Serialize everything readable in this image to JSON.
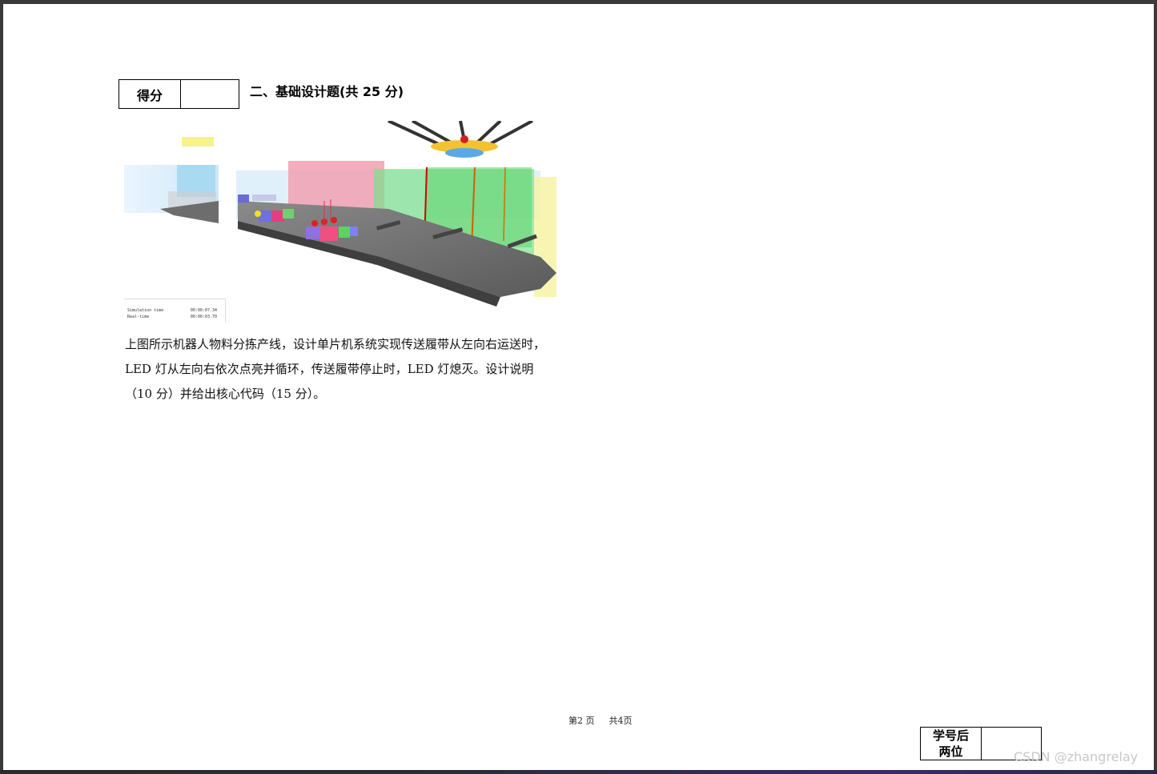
{
  "score_box": {
    "label": "得分",
    "value": ""
  },
  "section": {
    "title": "二、基础设计题(共 25 分)"
  },
  "figure": {
    "sim_time_label": "Simulation time",
    "sim_time_value": "00:00:07.34",
    "real_time_label": "Real-time",
    "real_time_value": "00:00:03.70"
  },
  "question": {
    "lines": [
      "上图所示机器人物料分拣产线，设计单片机系统实现传送履带从左向右运送时，",
      "LED 灯从左向右依次点亮并循环，传送履带停止时，LED 灯熄灭。设计说明",
      "（10 分）并给出核心代码（15 分）。"
    ]
  },
  "footer": {
    "page": "第2  页",
    "total": "共4页"
  },
  "id_box": {
    "label_line1": "学号后",
    "label_line2": "两位",
    "value": ""
  },
  "watermark": "CSDN @zhangrelay"
}
